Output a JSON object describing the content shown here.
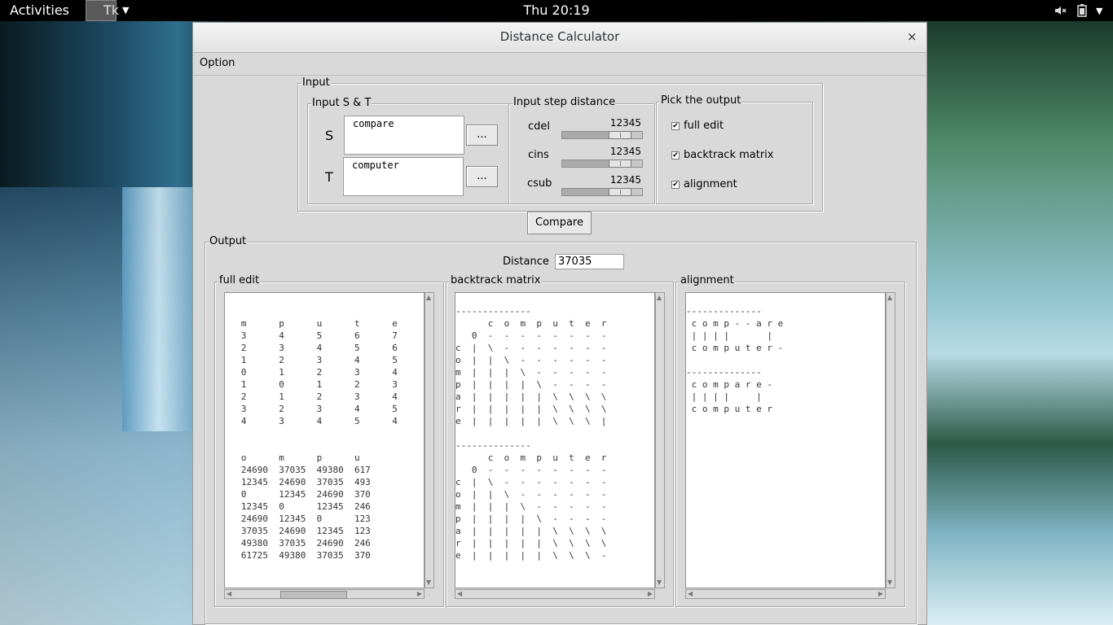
{
  "topbar": {
    "activities": "Activities",
    "app_name": "Tk",
    "clock": "Thu 20:19",
    "icons": [
      "volume-muted-icon",
      "battery-icon",
      "system-menu-icon"
    ]
  },
  "window": {
    "title": "Distance Calculator",
    "close_glyph": "×",
    "menu": {
      "option": "Option"
    }
  },
  "input": {
    "frame_label": "Input",
    "st": {
      "frame_label": "Input S & T",
      "s_label": "S",
      "s_value": "compare",
      "t_label": "T",
      "t_value": "computer",
      "browse_label": "..."
    },
    "step": {
      "frame_label": "Input step distance",
      "sliders": [
        {
          "name": "cdel",
          "value": "12345",
          "level": 0.82
        },
        {
          "name": "cins",
          "value": "12345",
          "level": 0.82
        },
        {
          "name": "csub",
          "value": "12345",
          "level": 0.82
        }
      ]
    },
    "pick": {
      "frame_label": "Pick the output",
      "options": [
        {
          "label": "full edit",
          "checked": true
        },
        {
          "label": "backtrack matrix",
          "checked": true
        },
        {
          "label": "alignment",
          "checked": true
        }
      ]
    }
  },
  "compare_label": "Compare",
  "output": {
    "frame_label": "Output",
    "distance_label": "Distance",
    "distance_value": "37035",
    "full_edit": {
      "label": "full edit",
      "text": "\n\n   m      p      u      t      e\n   3      4      5      6      7\n   2      3      4      5      6\n   1      2      3      4      5\n   0      1      2      3      4\n   1      0      1      2      3\n   2      1      2      3      4\n   3      2      3      4      5\n   4      3      4      5      4\n\n\n   o      m      p      u\n   24690  37035  49380  617\n   12345  24690  37035  493\n   0      12345  24690  370\n   12345  0      12345  246\n   24690  12345  0      123\n   37035  24690  12345  123\n   49380  37035  24690  246\n   61725  49380  37035  370"
    },
    "backtrack": {
      "label": "backtrack matrix",
      "text": "\n--------------\n      c  o  m  p  u  t  e  r\n   0  -  -  -  -  -  -  -  -\nc  |  \\  -  -  -  -  -  -  -\no  |  |  \\  -  -  -  -  -  -\nm  |  |  |  \\  -  -  -  -  -\np  |  |  |  |  \\  -  -  -  -\na  |  |  |  |  |  \\  \\  \\  \\\nr  |  |  |  |  |  \\  \\  \\  \\\ne  |  |  |  |  |  \\  \\  \\  |\n\n--------------\n      c  o  m  p  u  t  e  r\n   0  -  -  -  -  -  -  -  -\nc  |  \\  -  -  -  -  -  -  -\no  |  |  \\  -  -  -  -  -  -\nm  |  |  |  \\  -  -  -  -  -\np  |  |  |  |  \\  -  -  -  -\na  |  |  |  |  |  \\  \\  \\  \\\nr  |  |  |  |  |  \\  \\  \\  \\\ne  |  |  |  |  |  \\  \\  \\  -"
    },
    "alignment": {
      "label": "alignment",
      "text": "\n--------------\n c o m p - - a r e\n | | | |       |\n c o m p u t e r -\n\n--------------\n c o m p a r e -\n | | | |     |\n c o m p u t e r"
    }
  }
}
